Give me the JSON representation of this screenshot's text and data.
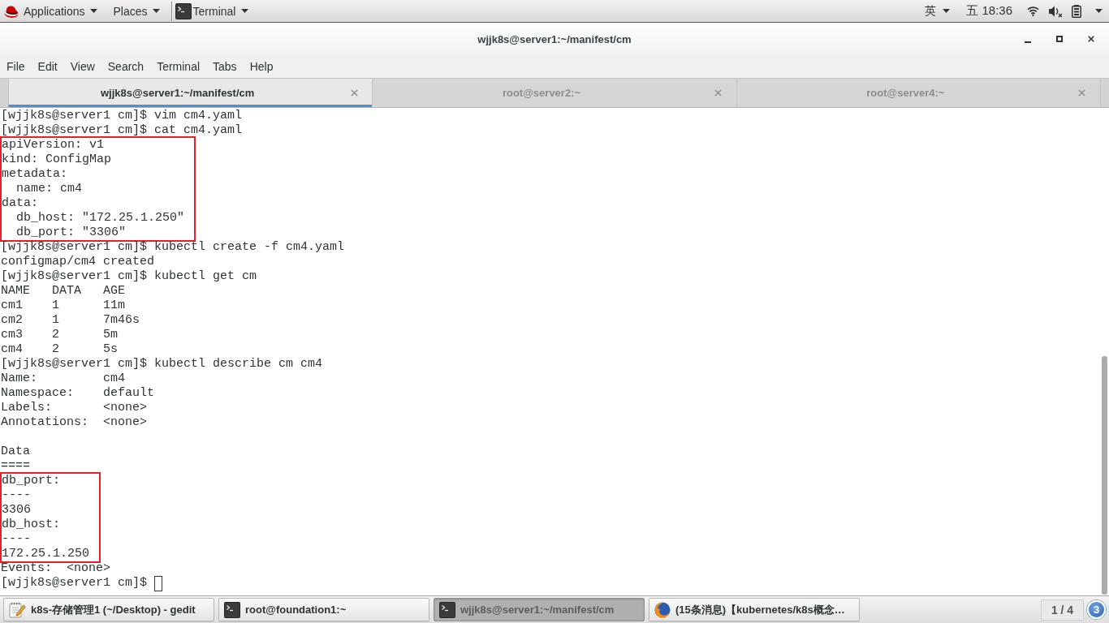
{
  "top_bar": {
    "menus": [
      {
        "kind": "applications",
        "label": "Applications"
      },
      {
        "kind": "places",
        "label": "Places"
      },
      {
        "kind": "app",
        "label": "Terminal"
      }
    ],
    "input_method": "英",
    "clock": "五 18:36"
  },
  "window": {
    "title": "wjjk8s@server1:~/manifest/cm"
  },
  "menu_bar": [
    "File",
    "Edit",
    "View",
    "Search",
    "Terminal",
    "Tabs",
    "Help"
  ],
  "tabs": [
    {
      "label": "wjjk8s@server1:~/manifest/cm",
      "selected": true
    },
    {
      "label": "root@server2:~",
      "selected": false
    },
    {
      "label": "root@server4:~",
      "selected": false
    }
  ],
  "terminal": {
    "blocks": [
      {
        "kind": "plain",
        "lines": [
          "[wjjk8s@server1 cm]$ vim cm4.yaml",
          "[wjjk8s@server1 cm]$ cat cm4.yaml"
        ]
      },
      {
        "kind": "highlighted",
        "lines": [
          "apiVersion: v1",
          "kind: ConfigMap",
          "metadata:",
          "  name: cm4",
          "data:",
          "  db_host: \"172.25.1.250\"",
          "  db_port: \"3306\""
        ]
      },
      {
        "kind": "plain",
        "lines": [
          "[wjjk8s@server1 cm]$ kubectl create -f cm4.yaml",
          "configmap/cm4 created",
          "[wjjk8s@server1 cm]$ kubectl get cm",
          "NAME   DATA   AGE",
          "cm1    1      11m",
          "cm2    1      7m46s",
          "cm3    2      5m",
          "cm4    2      5s",
          "[wjjk8s@server1 cm]$ kubectl describe cm cm4",
          "Name:         cm4",
          "Namespace:    default",
          "Labels:       <none>",
          "Annotations:  <none>"
        ]
      },
      {
        "kind": "blank"
      },
      {
        "kind": "plain",
        "lines": [
          "Data",
          "===="
        ]
      },
      {
        "kind": "highlighted",
        "lines": [
          "db_port:",
          "----",
          "3306",
          "db_host:",
          "----",
          "172.25.1.250"
        ]
      },
      {
        "kind": "plain",
        "lines": [
          "Events:  <none>",
          "[wjjk8s@server1 cm]$"
        ]
      }
    ],
    "cursor": true
  },
  "taskbar": {
    "items": [
      {
        "kind": "editor",
        "label": "k8s-存储管理1 (~/Desktop) - gedit",
        "selected": false
      },
      {
        "kind": "terminal",
        "label": "root@foundation1:~",
        "selected": false
      },
      {
        "kind": "terminal",
        "label": "wjjk8s@server1:~/manifest/cm",
        "selected": true
      },
      {
        "kind": "browser",
        "label": "(15条消息)【kubernetes/k8s概念…",
        "selected": false
      }
    ],
    "workspace_indicator": "1 / 4",
    "notification_count": "3"
  }
}
